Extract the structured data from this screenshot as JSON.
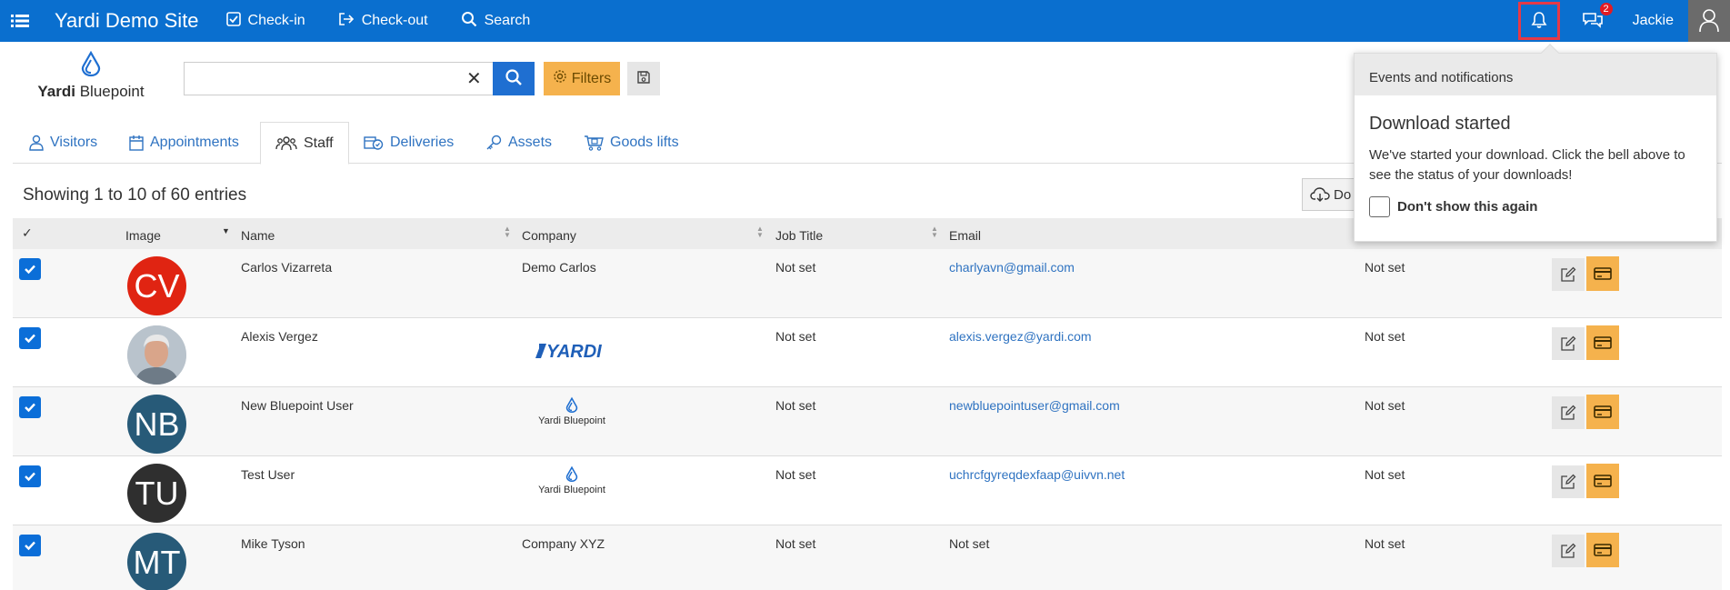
{
  "app": {
    "title": "Yardi Demo Site",
    "nav": [
      {
        "label": "Check-in",
        "icon": "check-square-icon"
      },
      {
        "label": "Check-out",
        "icon": "sign-out-icon"
      },
      {
        "label": "Search",
        "icon": "search-icon"
      }
    ],
    "notifications_badge": "2",
    "user_name": "Jackie"
  },
  "logo": {
    "brand": "Yardi",
    "product": "Bluepoint"
  },
  "search": {
    "value": "",
    "placeholder": "",
    "clear_glyph": "✕",
    "filters_label": "Filters"
  },
  "tabs": [
    {
      "label": "Visitors",
      "icon": "visitor-icon",
      "active": false
    },
    {
      "label": "Appointments",
      "icon": "calendar-icon",
      "active": false
    },
    {
      "label": "Staff",
      "icon": "users-icon",
      "active": true
    },
    {
      "label": "Deliveries",
      "icon": "delivery-icon",
      "active": false
    },
    {
      "label": "Assets",
      "icon": "key-icon",
      "active": false
    },
    {
      "label": "Goods lifts",
      "icon": "cart-icon",
      "active": false
    }
  ],
  "table": {
    "info": "Showing 1 to 10 of 60 entries",
    "download_label": "Do",
    "headers": {
      "check": "✓",
      "image": "Image",
      "name": "Name",
      "company": "Company",
      "job_title": "Job Title",
      "email": "Email"
    },
    "rows": [
      {
        "initials": "CV",
        "avatar_color": "#e02412",
        "name": "Carlos Vizarreta",
        "company": "Demo Carlos",
        "company_logo": "",
        "job_title": "Not set",
        "email": "charlyavn@gmail.com",
        "email_is_link": true,
        "extra": "Not set"
      },
      {
        "initials": "",
        "avatar_color": "#b9c3cc",
        "avatar_photo": true,
        "name": "Alexis Vergez",
        "company": "",
        "company_logo": "YARDI",
        "job_title": "Not set",
        "email": "alexis.vergez@yardi.com",
        "email_is_link": true,
        "extra": "Not set"
      },
      {
        "initials": "NB",
        "avatar_color": "#275a78",
        "name": "New Bluepoint User",
        "company": "",
        "company_logo": "bluepoint",
        "job_title": "Not set",
        "email": "newbluepointuser@gmail.com",
        "email_is_link": true,
        "extra": "Not set"
      },
      {
        "initials": "TU",
        "avatar_color": "#2f2f2f",
        "name": "Test User",
        "company": "",
        "company_logo": "bluepoint",
        "job_title": "Not set",
        "email": "uchrcfgyreqdexfaap@uivvn.net",
        "email_is_link": true,
        "extra": "Not set"
      },
      {
        "initials": "MT",
        "avatar_color": "#275a78",
        "name": "Mike Tyson",
        "company": "Company XYZ",
        "company_logo": "",
        "job_title": "Not set",
        "email": "Not set",
        "email_is_link": false,
        "extra": "Not set"
      }
    ]
  },
  "popup": {
    "header": "Events and notifications",
    "title": "Download started",
    "text": "We've started your download. Click the bell above to see the status of your downloads!",
    "checkbox_label": "Don't show this again"
  },
  "colors": {
    "topbar": "#0a6fcf",
    "accent_orange": "#f5b24d",
    "link": "#2f73c1",
    "highlight": "#e63946"
  }
}
